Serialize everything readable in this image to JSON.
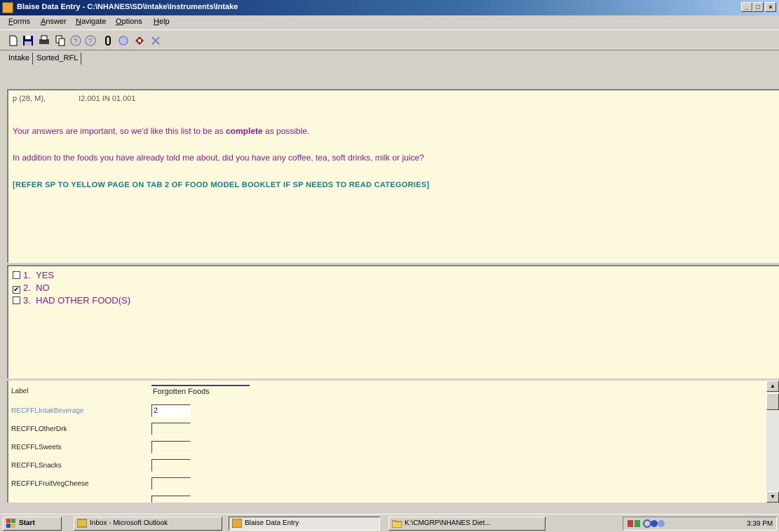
{
  "window": {
    "title": "Blaise Data Entry - C:\\NHANES\\SD\\Intake\\Instruments\\Intake",
    "minimize_label": "_",
    "maximize_label": "□",
    "close_label": "×"
  },
  "menu": [
    "Forms",
    "Answer",
    "Navigate",
    "Options",
    "Help"
  ],
  "toolbar": {
    "buttons": [
      "new-form-icon",
      "save-icon",
      "print-icon",
      "copy-icon",
      "help-icon",
      "info-icon",
      "clip-icon",
      "search-icon",
      "remark-icon",
      "exit-icon"
    ]
  },
  "tabs": [
    {
      "label": "Intake",
      "active": true
    },
    {
      "label": "Sorted_RFL",
      "active": false
    }
  ],
  "question": {
    "header_left": "p (28, M),",
    "header_right": "I2.001 IN 01.001",
    "line1_pre": "Your answers are important, so we'd like this list to be as ",
    "line1_bold": "complete",
    "line1_post": " as possible.",
    "line2": "In addition to the foods you have already told me about, did you have any coffee, tea, soft drinks, milk or juice?",
    "line3": "[REFER SP TO YELLOW PAGE ON TAB 2 OF FOOD MODEL BOOKLET IF SP NEEDS TO READ CATEGORIES]"
  },
  "answers": [
    {
      "code": "1.",
      "label": "YES",
      "checked": false
    },
    {
      "code": "2.",
      "label": "NO",
      "checked": true
    },
    {
      "code": "3.",
      "label": "HAD OTHER FOOD(S)",
      "checked": false
    }
  ],
  "fields": {
    "header_label": "Label",
    "header_value": "Forgotten Foods",
    "rows": [
      {
        "name": "RECFFLIntakBeverage",
        "value": "2",
        "current": true
      },
      {
        "name": "RECFFLOtherDrk",
        "value": ""
      },
      {
        "name": "RECFFLSweets",
        "value": ""
      },
      {
        "name": "RECFFLSnacks",
        "value": ""
      },
      {
        "name": "RECFFLFruitVegCheese",
        "value": ""
      }
    ]
  },
  "taskbar": {
    "start_label": "Start",
    "buttons": [
      {
        "label": "Inbox - Microsoft Outlook",
        "active": false
      },
      {
        "label": "Blaise Data Entry",
        "active": true
      },
      {
        "label": "K:\\CMGRP\\NHANES Diet...",
        "active": false
      }
    ],
    "clock": "3:39 PM"
  },
  "colors": {
    "pane_bg": "#fdf9dc",
    "question_text": "#8b1a8b",
    "instruction_text": "#0a7f8f",
    "title_bar": "#0a246a"
  }
}
